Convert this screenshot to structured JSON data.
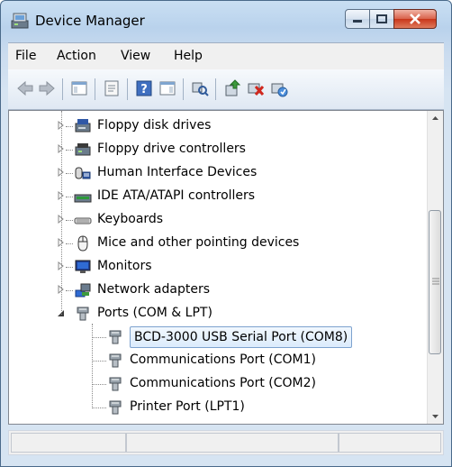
{
  "window": {
    "title": "Device Manager"
  },
  "menu": {
    "items": [
      "File",
      "Action",
      "View",
      "Help"
    ]
  },
  "tree": {
    "items": [
      {
        "label": "Floppy disk drives",
        "icon": "floppy-drive-icon"
      },
      {
        "label": "Floppy drive controllers",
        "icon": "controller-icon"
      },
      {
        "label": "Human Interface Devices",
        "icon": "hid-icon"
      },
      {
        "label": "IDE ATA/ATAPI controllers",
        "icon": "ide-controller-icon"
      },
      {
        "label": "Keyboards",
        "icon": "keyboard-icon"
      },
      {
        "label": "Mice and other pointing devices",
        "icon": "mouse-icon"
      },
      {
        "label": "Monitors",
        "icon": "monitor-icon"
      },
      {
        "label": "Network adapters",
        "icon": "network-adapter-icon"
      },
      {
        "label": "Ports (COM & LPT)",
        "icon": "port-icon"
      },
      {
        "label": "BCD-3000 USB Serial Port (COM8)",
        "icon": "port-icon"
      },
      {
        "label": "Communications Port (COM1)",
        "icon": "port-icon"
      },
      {
        "label": "Communications Port (COM2)",
        "icon": "port-icon"
      },
      {
        "label": "Printer Port (LPT1)",
        "icon": "port-icon"
      }
    ]
  }
}
